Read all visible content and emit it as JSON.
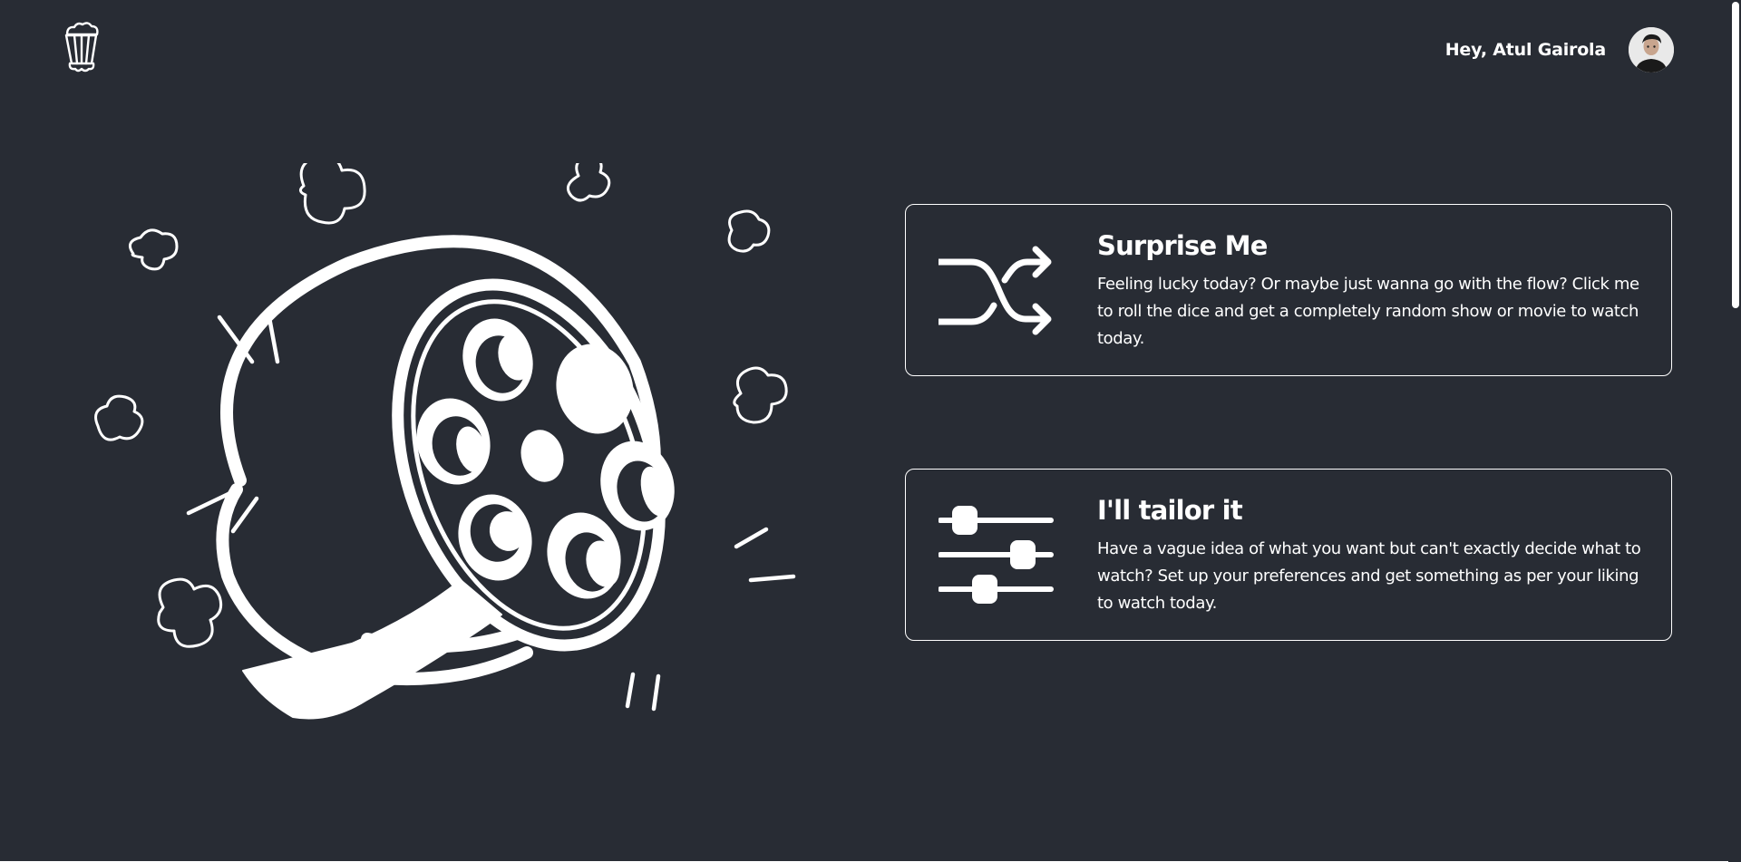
{
  "header": {
    "logo_icon": "popcorn-bucket-icon",
    "greeting": "Hey, Atul Gairola",
    "avatar_icon": "user-avatar"
  },
  "illustration": {
    "icon": "film-reel-with-popcorn-illustration"
  },
  "options": [
    {
      "icon": "shuffle-icon",
      "title": "Surprise Me",
      "description": "Feeling lucky today? Or maybe just wanna go with the flow? Click me to roll the dice and get a completely random show or movie to watch today."
    },
    {
      "icon": "sliders-icon",
      "title": "I'll tailor it",
      "description": "Have a vague idea of what you want but can't exactly decide what to watch? Set up your preferences and get something as per your liking to watch today."
    }
  ],
  "colors": {
    "background": "#282c34",
    "foreground": "#ffffff"
  }
}
